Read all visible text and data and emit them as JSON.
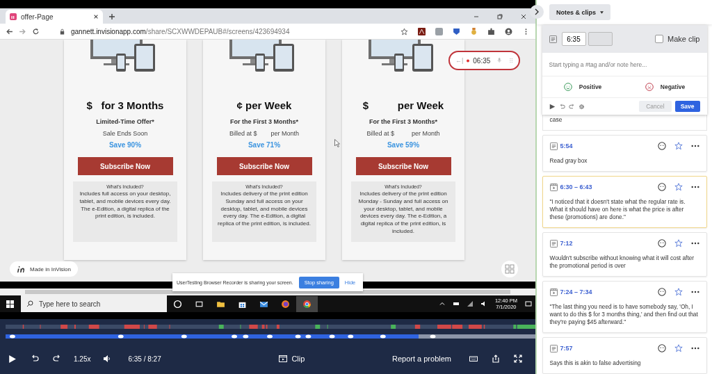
{
  "browser": {
    "tab_title": "offer-Page",
    "url_host": "gannett.invisionapp.com",
    "url_path": "/share/SCXWWDEPAUB#/screens/423694934"
  },
  "offers": [
    {
      "price": "$   for 3 Months",
      "term": "Limited-Time Offer*",
      "billing": "Sale Ends Soon",
      "savings": "Save 90%",
      "button": "Subscribe Now",
      "included_title": "What's Included?",
      "included_text": "Includes full access on your desktop, tablet, and mobile devices every day. The e-Edition, a digital replica of the print edition, is included."
    },
    {
      "price": "¢ per Week",
      "term": "For the First 3 Months*",
      "billing": "Billed at $        per Month",
      "savings": "Save 71%",
      "button": "Subscribe Now",
      "included_title": "What's Included?",
      "included_text": "Includes delivery of the print edition Sunday and full access on your desktop, tablet, and mobile devices every day. The e-Edition, a digital replica of the print edition, is included."
    },
    {
      "price": "$          per Week",
      "term": "For the First 3 Months*",
      "billing": "Billed at $          per Month",
      "savings": "Save 59%",
      "button": "Subscribe Now",
      "included_title": "What's Included?",
      "included_text": "Includes delivery of the print edition Monday - Sunday and full access on your desktop, tablet, and mobile devices every day. The e-Edition, a digital replica of the print edition, is included."
    }
  ],
  "recorder_pill": {
    "back": "←|",
    "time": "06:35"
  },
  "invision_badge": "Made in InVision",
  "share_bar": {
    "message": "UserTesting Browser Recorder is sharing your screen.",
    "stop": "Stop sharing",
    "hide": "Hide"
  },
  "taskbar": {
    "search_placeholder": "Type here to search",
    "time": "12:40 PM",
    "date": "7/1/2020"
  },
  "player": {
    "level": 0.78,
    "speed": "1.25x",
    "time": "6:35 / 8:27",
    "clip": "Clip",
    "report": "Report a problem"
  },
  "panel": {
    "menu": "Notes & clips",
    "editor": {
      "start": "6:35",
      "make_clip": "Make clip",
      "make_clip_checked": false,
      "placeholder": "Start typing a #tag and/or note here...",
      "positive": "Positive",
      "negative": "Negative",
      "cancel": "Cancel",
      "save": "Save"
    },
    "partial_note": "case",
    "notes": [
      {
        "kind": "note",
        "time": "5:54",
        "text": "Read gray box",
        "selected": false
      },
      {
        "kind": "clip",
        "time": "6:30 – 6:43",
        "text": "\"I noticed that it doesn't state what the regular rate is. What it should have on here is what the price is after these (promotions) are done.\"",
        "selected": true
      },
      {
        "kind": "note",
        "time": "7:12",
        "text": "Wouldn't subscribe without knowing what it will cost after the promotional period is over",
        "selected": false
      },
      {
        "kind": "clip",
        "time": "7:24 – 7:34",
        "text": "\"The last thing you need is to have somebody say, 'Oh, I want to do this $   for 3 months thing,' and then find out that they're paying $45 afterward.\"",
        "selected": false
      },
      {
        "kind": "note",
        "time": "7:57",
        "text": "Says this is akin to false advertising",
        "selected": false
      }
    ]
  }
}
